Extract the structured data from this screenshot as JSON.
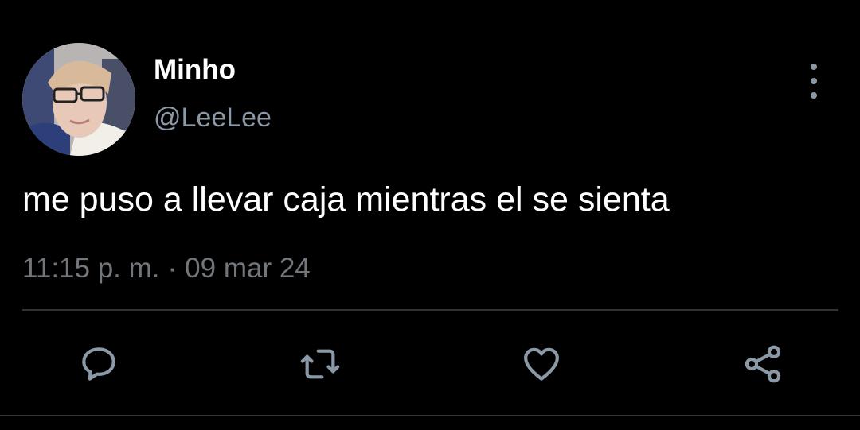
{
  "tweet": {
    "display_name": "Minho",
    "handle": "@LeeLee",
    "text": "me puso a llevar caja mientras el se sienta",
    "time": "11:15 p. m.",
    "separator": "·",
    "date": "09 mar 24"
  },
  "icons": {
    "more": "more-vertical-icon",
    "reply": "reply-icon",
    "retweet": "retweet-icon",
    "like": "heart-icon",
    "share": "share-icon"
  },
  "colors": {
    "background": "#000000",
    "primary_text": "#ffffff",
    "secondary_text": "#8b98a5",
    "icon": "#8b98a5",
    "divider": "#2f3336"
  }
}
